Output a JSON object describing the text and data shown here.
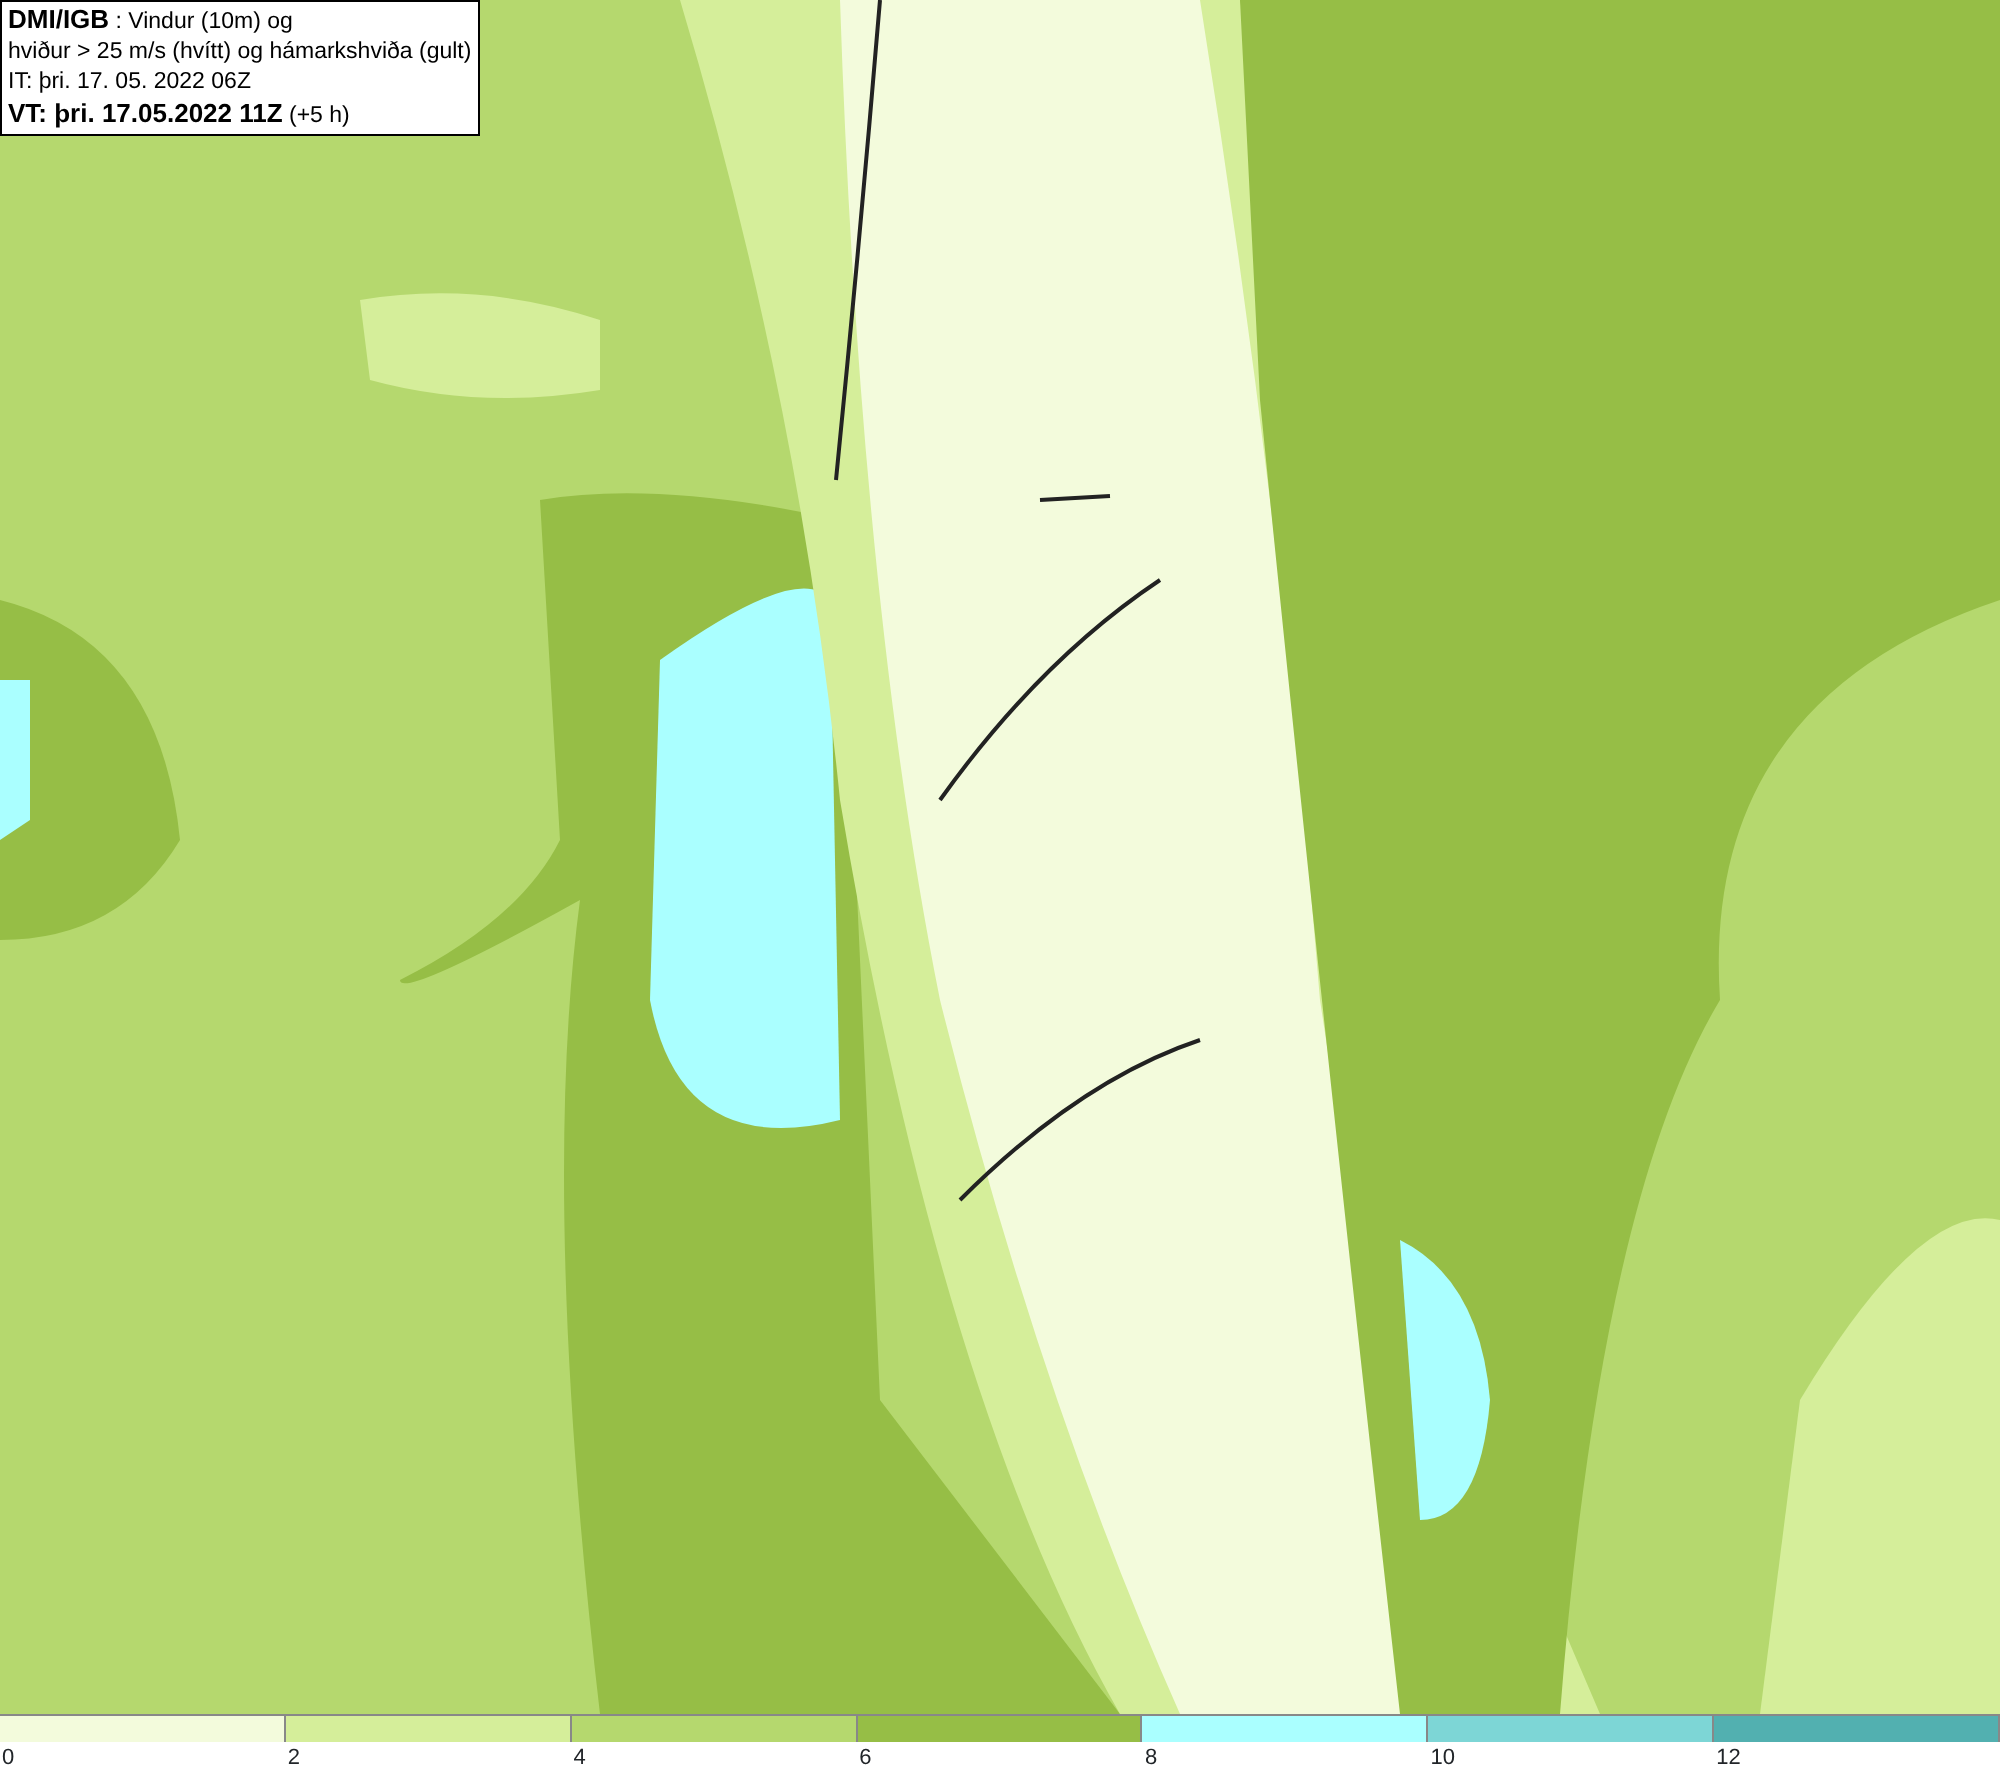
{
  "header": {
    "lines": [
      "**DMI/IGB** : Vindur (10m) og",
      "hviður > 25 m/s (hvítt) og hámarkshviða (gult)",
      "IT: þri. 17. 05. 2022 06Z",
      "**VT: þri. 17.05.2022 11Z** (+5 h)"
    ]
  },
  "legend": [
    {
      "label": "0",
      "color": "#f3fbdc"
    },
    {
      "label": "2",
      "color": "#d5ee9a"
    },
    {
      "label": "4",
      "color": "#b5d86e"
    },
    {
      "label": "6",
      "color": "#96be46"
    },
    {
      "label": "8",
      "color": "#aaffff"
    },
    {
      "label": "10",
      "color": "#7dd6d6"
    },
    {
      "label": "12",
      "color": "#52b0b0"
    }
  ]
}
